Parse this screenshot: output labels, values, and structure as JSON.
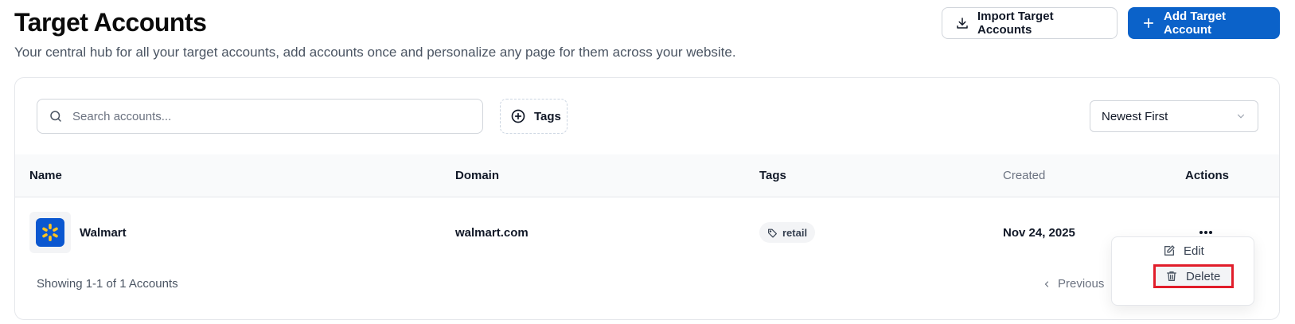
{
  "header": {
    "title": "Target Accounts",
    "subtitle": "Your central hub for all your target accounts, add accounts once and personalize any page for them across your website.",
    "import_button": "Import Target Accounts",
    "add_button": "Add Target Account"
  },
  "toolbar": {
    "search_placeholder": "Search accounts...",
    "tags_label": "Tags",
    "sort_value": "Newest First"
  },
  "table": {
    "columns": [
      "Name",
      "Domain",
      "Tags",
      "Created",
      "Actions"
    ],
    "rows": [
      {
        "name": "Walmart",
        "domain": "walmart.com",
        "tag": "retail",
        "created": "Nov 24, 2025"
      }
    ]
  },
  "footer": {
    "showing": "Showing 1-1 of 1 Accounts",
    "previous": "Previous"
  },
  "menu": {
    "edit": "Edit",
    "delete": "Delete"
  },
  "colors": {
    "primary": "#0b62c9",
    "highlight": "#e11d2a",
    "walmart_blue": "#0b57d0",
    "walmart_yellow": "#ffc220"
  },
  "icons": [
    "download-icon",
    "plus-icon",
    "search-icon",
    "plus-circle-icon",
    "chevron-down-icon",
    "walmart-logo",
    "tag-icon",
    "more-icon",
    "chevron-left-icon",
    "edit-icon",
    "trash-icon"
  ]
}
